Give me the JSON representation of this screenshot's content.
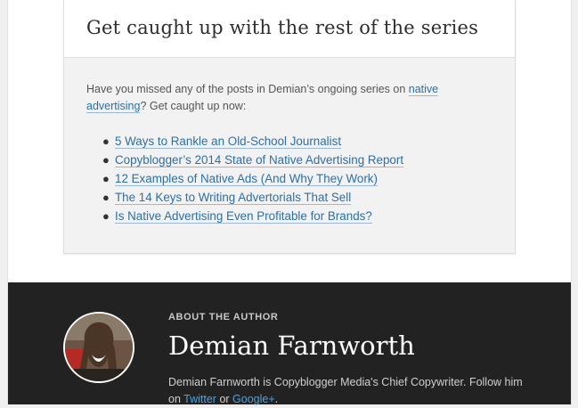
{
  "series": {
    "title": "Get caught up with the rest of the series",
    "intro_before": "Have you missed any of the posts in Demian’s ongoing series on ",
    "intro_link": "native advertising",
    "intro_after": "? Get caught up now:",
    "posts": [
      "5 Ways to Rankle an Old-School Journalist",
      "Copyblogger’s 2014 State of Native Advertising Report",
      "12 Examples of Native Ads (And Why They Work)",
      "The 14 Keys to Writing Advertorials That Sell",
      "Is Native Advertising Even Profitable for Brands?"
    ]
  },
  "author": {
    "label": "ABOUT THE AUTHOR",
    "name": "Demian Farnworth",
    "bio_before": "Demian Farnworth is Copyblogger Media's Chief Copywriter. Follow him on ",
    "twitter": "Twitter",
    "bio_mid": " or ",
    "googleplus": "Google+",
    "bio_end": "."
  },
  "colors": {
    "link": "#2d6fa6",
    "author_bg": "#222222",
    "author_link": "#4aa3e0"
  }
}
